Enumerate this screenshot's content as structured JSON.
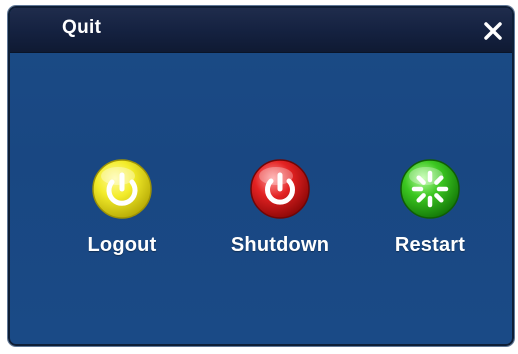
{
  "dialog": {
    "title": "Quit",
    "close_icon": "close-icon"
  },
  "actions": [
    {
      "label": "Logout",
      "icon": "logout-power-icon",
      "color": "#e8e21c"
    },
    {
      "label": "Shutdown",
      "icon": "shutdown-power-icon",
      "color": "#d81c1c"
    },
    {
      "label": "Restart",
      "icon": "restart-spinner-icon",
      "color": "#37c21e"
    }
  ],
  "colors": {
    "dialog_background": "#1a4a86",
    "titlebar_background": "#152241",
    "text": "#ffffff"
  }
}
